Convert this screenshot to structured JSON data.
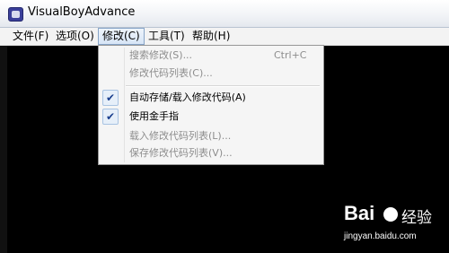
{
  "window": {
    "title": "VisualBoyAdvance"
  },
  "menubar": {
    "items": [
      "文件(F)",
      "选项(O)",
      "修改(C)",
      "工具(T)",
      "帮助(H)"
    ]
  },
  "dropdown": {
    "items": [
      {
        "label": "搜索修改(S)...",
        "shortcut": "Ctrl+C"
      },
      {
        "label": "修改代码列表(C)..."
      },
      {
        "label": "自动存储/载入修改代码(A)",
        "checked": true
      },
      {
        "label": "使用金手指",
        "checked": true
      },
      {
        "label": "载入修改代码列表(L)..."
      },
      {
        "label": "保存修改代码列表(V)..."
      }
    ],
    "check_glyph": "✔"
  },
  "watermark": {
    "logo": "Bai",
    "brand": "经验",
    "url": "jingyan.baidu.com"
  }
}
